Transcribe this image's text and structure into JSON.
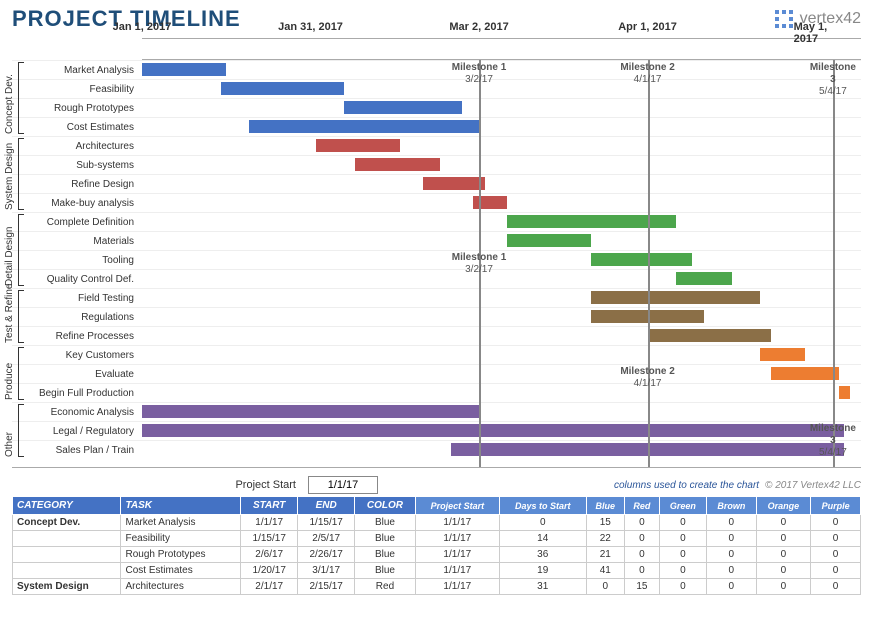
{
  "title": "PROJECT TIMELINE",
  "logo": "vertex42",
  "copyright": "© 2017 Vertex42 LLC",
  "columns_note": "columns used to create the chart",
  "project_start_label": "Project Start",
  "project_start_value": "1/1/17",
  "axis_ticks": [
    {
      "label": "Jan 1, 2017",
      "day": 0
    },
    {
      "label": "Jan 31, 2017",
      "day": 30
    },
    {
      "label": "Mar 2, 2017",
      "day": 60
    },
    {
      "label": "Apr 1, 2017",
      "day": 90
    },
    {
      "label": "May 1, 2017",
      "day": 120
    }
  ],
  "milestones": [
    {
      "name": "Milestone 1",
      "date": "3/2/17",
      "day": 60,
      "label_rows": [
        0,
        10
      ]
    },
    {
      "name": "Milestone 2",
      "date": "4/1/17",
      "day": 90,
      "label_rows": [
        0,
        16
      ]
    },
    {
      "name": "Milestone 3",
      "date": "5/4/17",
      "day": 123,
      "label_rows": [
        0,
        19
      ]
    }
  ],
  "groups": [
    {
      "name": "Concept Dev.",
      "start": 0,
      "end": 4
    },
    {
      "name": "System Design",
      "start": 4,
      "end": 8
    },
    {
      "name": "Detail Design",
      "start": 8,
      "end": 12
    },
    {
      "name": "Test & Refine",
      "start": 12,
      "end": 15
    },
    {
      "name": "Produce",
      "start": 15,
      "end": 18
    },
    {
      "name": "Other",
      "start": 18,
      "end": 21
    }
  ],
  "chart_data": {
    "type": "bar",
    "xlabel": "",
    "ylabel": "",
    "xrange": [
      0,
      128
    ],
    "unit": "days from 1/1/2017",
    "tasks": [
      {
        "label": "Market Analysis",
        "start": 0,
        "dur": 15,
        "color": "Blue"
      },
      {
        "label": "Feasibility",
        "start": 14,
        "dur": 22,
        "color": "Blue"
      },
      {
        "label": "Rough Prototypes",
        "start": 36,
        "dur": 21,
        "color": "Blue"
      },
      {
        "label": "Cost Estimates",
        "start": 19,
        "dur": 41,
        "color": "Blue"
      },
      {
        "label": "Architectures",
        "start": 31,
        "dur": 15,
        "color": "Red"
      },
      {
        "label": "Sub-systems",
        "start": 38,
        "dur": 15,
        "color": "Red"
      },
      {
        "label": "Refine Design",
        "start": 50,
        "dur": 11,
        "color": "Red"
      },
      {
        "label": "Make-buy analysis",
        "start": 59,
        "dur": 6,
        "color": "Red"
      },
      {
        "label": "Complete Definition",
        "start": 65,
        "dur": 30,
        "color": "Green"
      },
      {
        "label": "Materials",
        "start": 65,
        "dur": 15,
        "color": "Green"
      },
      {
        "label": "Tooling",
        "start": 80,
        "dur": 18,
        "color": "Green"
      },
      {
        "label": "Quality Control Def.",
        "start": 95,
        "dur": 10,
        "color": "Green"
      },
      {
        "label": "Field Testing",
        "start": 80,
        "dur": 30,
        "color": "Brown"
      },
      {
        "label": "Regulations",
        "start": 80,
        "dur": 20,
        "color": "Brown"
      },
      {
        "label": "Refine Processes",
        "start": 90,
        "dur": 22,
        "color": "Brown"
      },
      {
        "label": "Key Customers",
        "start": 110,
        "dur": 8,
        "color": "Orange"
      },
      {
        "label": "Evaluate",
        "start": 112,
        "dur": 12,
        "color": "Orange"
      },
      {
        "label": "Begin Full Production",
        "start": 124,
        "dur": 2,
        "color": "Orange"
      },
      {
        "label": "Economic Analysis",
        "start": 0,
        "dur": 60,
        "color": "Purple"
      },
      {
        "label": "Legal / Regulatory",
        "start": 0,
        "dur": 125,
        "color": "Purple"
      },
      {
        "label": "Sales Plan / Train",
        "start": 55,
        "dur": 70,
        "color": "Purple"
      }
    ]
  },
  "table": {
    "headers": [
      "CATEGORY",
      "TASK",
      "START",
      "END",
      "COLOR"
    ],
    "sub_headers": [
      "Project Start",
      "Days to Start",
      "Blue",
      "Red",
      "Green",
      "Brown",
      "Orange",
      "Purple"
    ],
    "rows": [
      {
        "cat": "Concept Dev.",
        "task": "Market Analysis",
        "start": "1/1/17",
        "end": "1/15/17",
        "color": "Blue",
        "ps": "1/1/17",
        "dts": 0,
        "v": [
          15,
          0,
          0,
          0,
          0,
          0
        ]
      },
      {
        "cat": "",
        "task": "Feasibility",
        "start": "1/15/17",
        "end": "2/5/17",
        "color": "Blue",
        "ps": "1/1/17",
        "dts": 14,
        "v": [
          22,
          0,
          0,
          0,
          0,
          0
        ]
      },
      {
        "cat": "",
        "task": "Rough Prototypes",
        "start": "2/6/17",
        "end": "2/26/17",
        "color": "Blue",
        "ps": "1/1/17",
        "dts": 36,
        "v": [
          21,
          0,
          0,
          0,
          0,
          0
        ]
      },
      {
        "cat": "",
        "task": "Cost Estimates",
        "start": "1/20/17",
        "end": "3/1/17",
        "color": "Blue",
        "ps": "1/1/17",
        "dts": 19,
        "v": [
          41,
          0,
          0,
          0,
          0,
          0
        ]
      },
      {
        "cat": "System Design",
        "task": "Architectures",
        "start": "2/1/17",
        "end": "2/15/17",
        "color": "Red",
        "ps": "1/1/17",
        "dts": 31,
        "v": [
          0,
          15,
          0,
          0,
          0,
          0
        ]
      }
    ]
  }
}
